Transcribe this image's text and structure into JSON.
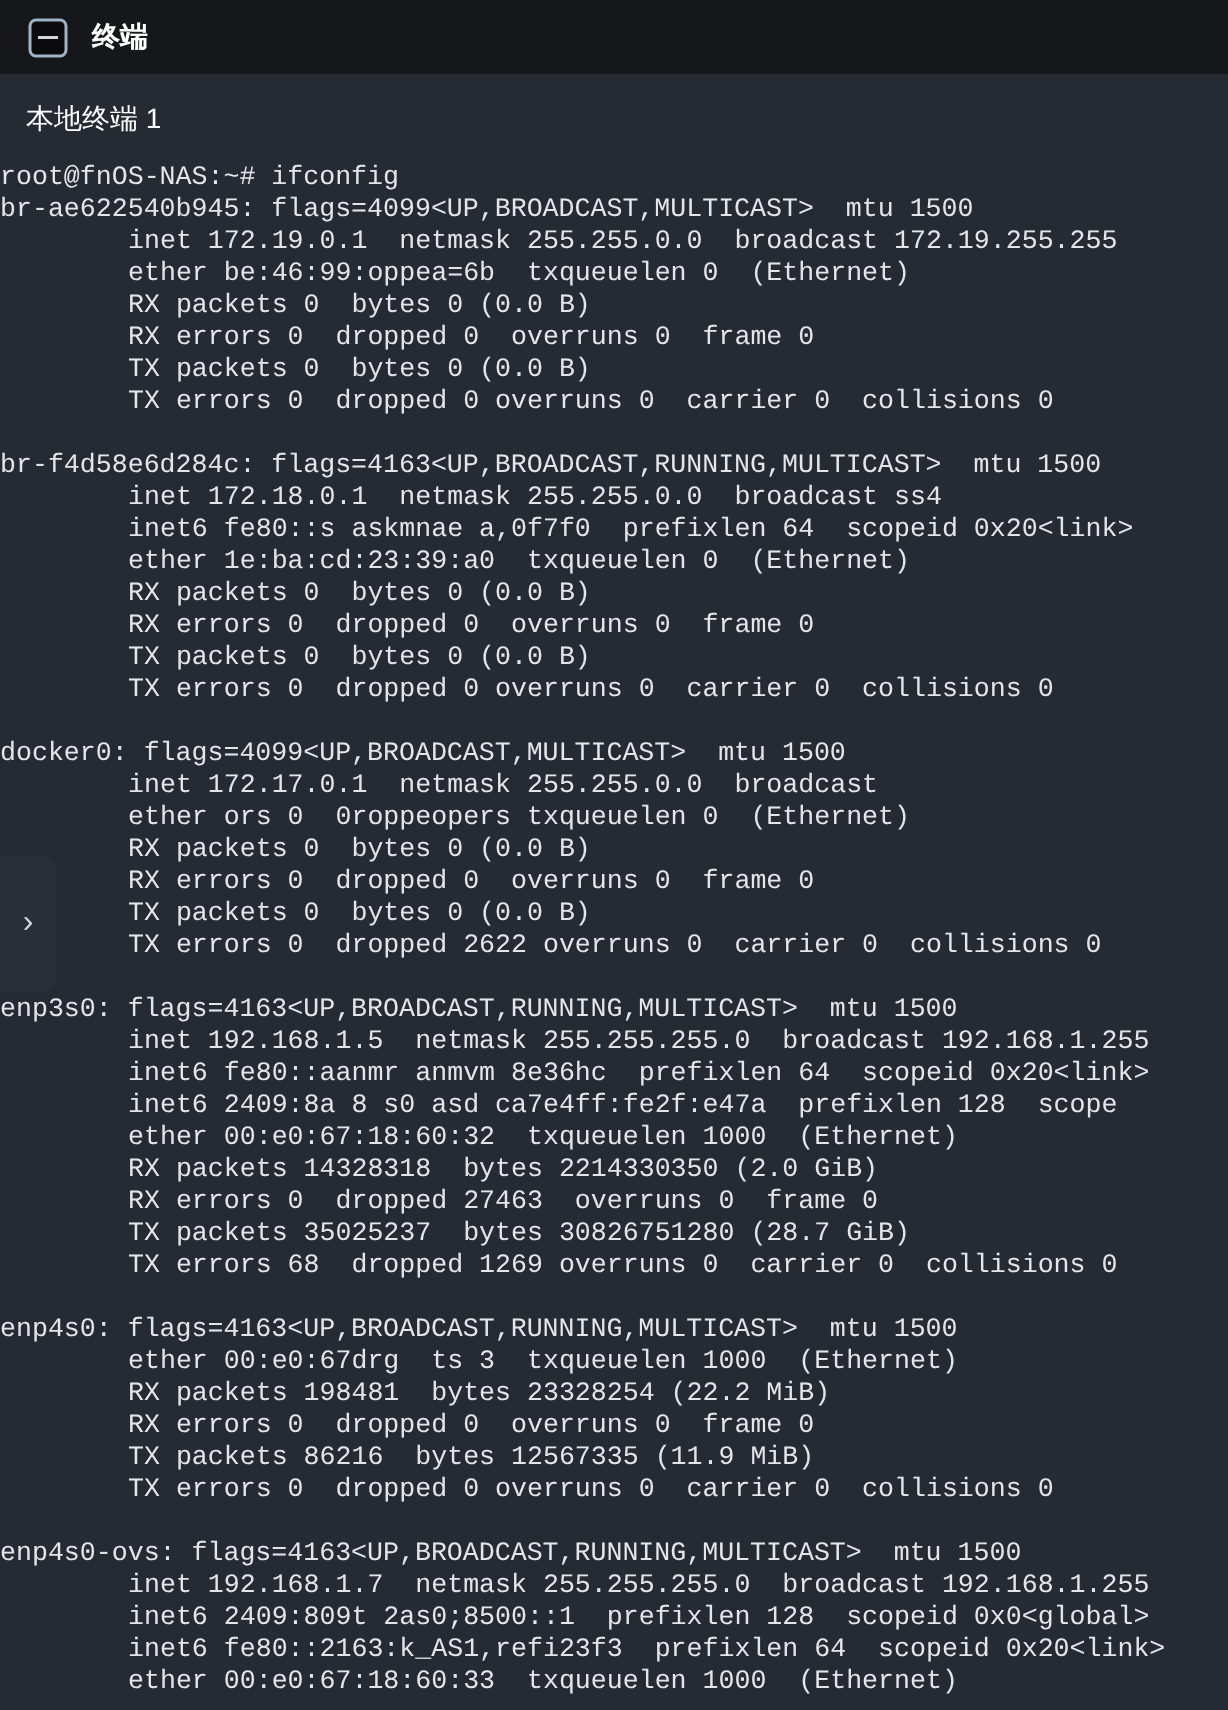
{
  "window": {
    "title": "终端"
  },
  "tabs": [
    {
      "label": "本地终端 1",
      "selected": true
    }
  ],
  "side_toggle": {
    "label": "›"
  },
  "terminal": {
    "prompt": "root@fnOS-NAS:~# ifconfig",
    "blocks": [
      {
        "header": "br-ae622540b945: flags=4099<UP,BROADCAST,MULTICAST>  mtu 1500",
        "details": [
          "inet 172.19.0.1  netmask 255.255.0.0  broadcast 172.19.255.255",
          "ether be:46:99:oppea=6b  txqueuelen 0  (Ethernet)",
          "RX packets 0  bytes 0 (0.0 B)",
          "RX errors 0  dropped 0  overruns 0  frame 0",
          "TX packets 0  bytes 0 (0.0 B)",
          "TX errors 0  dropped 0 overruns 0  carrier 0  collisions 0"
        ]
      },
      {
        "header": "br-f4d58e6d284c: flags=4163<UP,BROADCAST,RUNNING,MULTICAST>  mtu 1500",
        "details": [
          "inet 172.18.0.1  netmask 255.255.0.0  broadcast ss4",
          "inet6 fe80::s askmnae a,0f7f0  prefixlen 64  scopeid 0x20<link>",
          "ether 1e:ba:cd:23:39:a0  txqueuelen 0  (Ethernet)",
          "RX packets 0  bytes 0 (0.0 B)",
          "RX errors 0  dropped 0  overruns 0  frame 0",
          "TX packets 0  bytes 0 (0.0 B)",
          "TX errors 0  dropped 0 overruns 0  carrier 0  collisions 0"
        ]
      },
      {
        "header": "docker0: flags=4099<UP,BROADCAST,MULTICAST>  mtu 1500",
        "details": [
          "inet 172.17.0.1  netmask 255.255.0.0  broadcast",
          "ether ors 0  0roppeopers txqueuelen 0  (Ethernet)",
          "RX packets 0  bytes 0 (0.0 B)",
          "RX errors 0  dropped 0  overruns 0  frame 0",
          "TX packets 0  bytes 0 (0.0 B)",
          "TX errors 0  dropped 2622 overruns 0  carrier 0  collisions 0"
        ]
      },
      {
        "header": "enp3s0: flags=4163<UP,BROADCAST,RUNNING,MULTICAST>  mtu 1500",
        "details": [
          "inet 192.168.1.5  netmask 255.255.255.0  broadcast 192.168.1.255",
          "inet6 fe80::aanmr anmvm 8e36hc  prefixlen 64  scopeid 0x20<link>",
          "inet6 2409:8a 8 s0 asd ca7e4ff:fe2f:e47a  prefixlen 128  scope",
          "ether 00:e0:67:18:60:32  txqueuelen 1000  (Ethernet)",
          "RX packets 14328318  bytes 2214330350 (2.0 GiB)",
          "RX errors 0  dropped 27463  overruns 0  frame 0",
          "TX packets 35025237  bytes 30826751280 (28.7 GiB)",
          "TX errors 68  dropped 1269 overruns 0  carrier 0  collisions 0"
        ]
      },
      {
        "header": "enp4s0: flags=4163<UP,BROADCAST,RUNNING,MULTICAST>  mtu 1500",
        "details": [
          "ether 00:e0:67drg  ts 3  txqueuelen 1000  (Ethernet)",
          "RX packets 198481  bytes 23328254 (22.2 MiB)",
          "RX errors 0  dropped 0  overruns 0  frame 0",
          "TX packets 86216  bytes 12567335 (11.9 MiB)",
          "TX errors 0  dropped 0 overruns 0  carrier 0  collisions 0"
        ]
      },
      {
        "header": "enp4s0-ovs: flags=4163<UP,BROADCAST,RUNNING,MULTICAST>  mtu 1500",
        "details": [
          "inet 192.168.1.7  netmask 255.255.255.0  broadcast 192.168.1.255",
          "inet6 2409:809t 2as0;8500::1  prefixlen 128  scopeid 0x0<global>",
          "inet6 fe80::2163:k_AS1,refi23f3  prefixlen 64  scopeid 0x20<link>",
          "ether 00:e0:67:18:60:33  txqueuelen 1000  (Ethernet)"
        ]
      }
    ]
  }
}
